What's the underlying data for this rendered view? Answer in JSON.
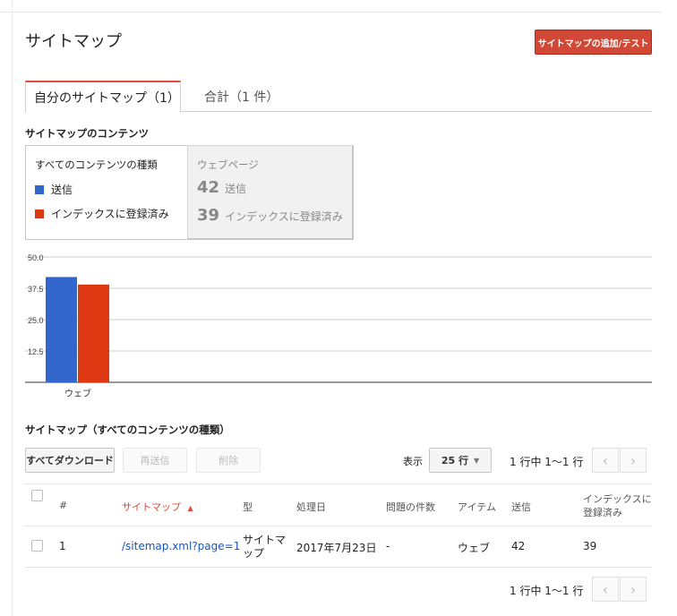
{
  "header": {
    "title": "サイトマップ",
    "add_button": "サイトマップの追加/テスト"
  },
  "tabs": [
    {
      "label": "自分のサイトマップ（1）",
      "active": true
    },
    {
      "label": "合計（1 件）",
      "active": false
    }
  ],
  "contents_section": {
    "heading": "サイトマップのコンテンツ",
    "legend_title": "すべてのコンテンツの種類",
    "legend": [
      {
        "label": "送信",
        "color": "#3366cc"
      },
      {
        "label": "インデックスに登録済み",
        "color": "#dc3912"
      }
    ],
    "stats_title": "ウェブページ",
    "stats": [
      {
        "value": "42",
        "label": "送信"
      },
      {
        "value": "39",
        "label": "インデックスに登録済み"
      }
    ]
  },
  "chart_data": {
    "type": "bar",
    "categories": [
      "ウェブ"
    ],
    "series": [
      {
        "name": "送信",
        "values": [
          42
        ],
        "color": "#3366cc"
      },
      {
        "name": "インデックスに登録済み",
        "values": [
          39
        ],
        "color": "#dc3912"
      }
    ],
    "yticks": [
      "50.0",
      "37.5",
      "25.0",
      "12.5"
    ],
    "ylim": [
      0,
      50
    ],
    "grid": true
  },
  "table_section": {
    "heading": "サイトマップ（すべてのコンテンツの種類）",
    "download_button": "すべてダウンロード",
    "resubmit_button": "再送信",
    "delete_button": "削除",
    "display_label": "表示",
    "rows_per_page": "25 行",
    "pager_text": "1 行中 1〜1 行",
    "columns": [
      "#",
      "サイトマップ",
      "型",
      "処理日",
      "問題の件数",
      "アイテム",
      "送信",
      "インデックスに登録済み"
    ],
    "sort_arrow": "▲",
    "rows": [
      {
        "num": "1",
        "sitemap": "/sitemap.xml?page=1",
        "type": "サイトマップ",
        "processed": "2017年7月23日",
        "issues": "-",
        "item": "ウェブ",
        "submitted": "42",
        "indexed": "39"
      }
    ]
  }
}
